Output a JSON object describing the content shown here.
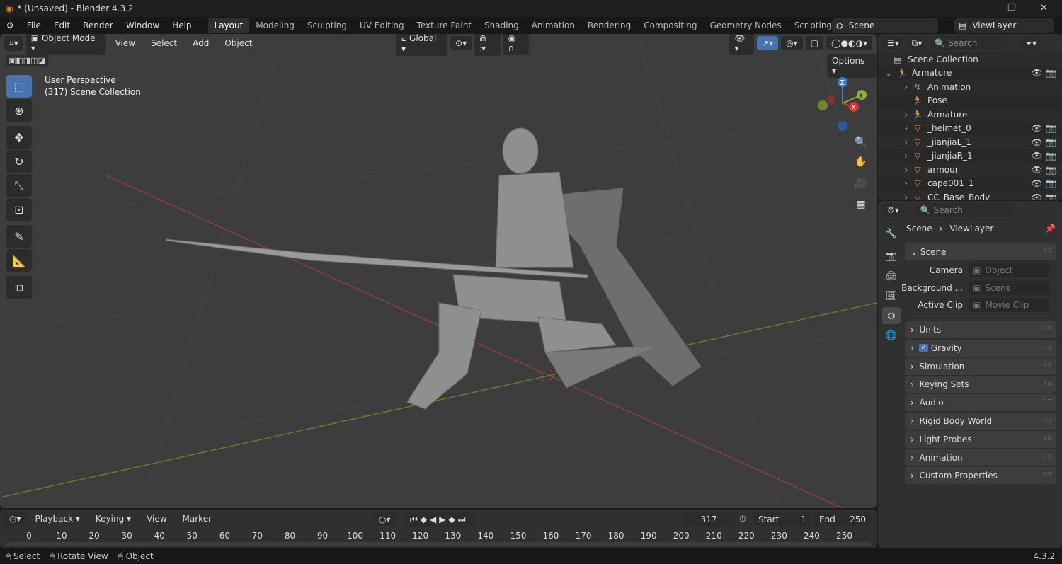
{
  "title": "* (Unsaved) - Blender 4.3.2",
  "menu": [
    "File",
    "Edit",
    "Render",
    "Window",
    "Help"
  ],
  "workspaces": [
    "Layout",
    "Modeling",
    "Sculpting",
    "UV Editing",
    "Texture Paint",
    "Shading",
    "Animation",
    "Rendering",
    "Compositing",
    "Geometry Nodes",
    "Scripting"
  ],
  "scene": "Scene",
  "view_layer": "ViewLayer",
  "viewport": {
    "mode": "Object Mode",
    "menus": [
      "View",
      "Select",
      "Add",
      "Object"
    ],
    "orientation": "Global",
    "options": "Options",
    "info1": "User Perspective",
    "info2": "(317) Scene Collection",
    "gizmo": {
      "z": "Z",
      "y": "Y",
      "x": "X"
    }
  },
  "outliner": {
    "search": "Search",
    "root": "Scene Collection",
    "rows": [
      {
        "name": "Armature",
        "icon": "armature",
        "indent": 1,
        "vis": true
      },
      {
        "name": "Animation",
        "icon": "action",
        "indent": 2,
        "vis": false
      },
      {
        "name": "Pose",
        "icon": "pose",
        "indent": 2,
        "vis": false
      },
      {
        "name": "Armature",
        "icon": "armature-data",
        "indent": 2,
        "vis": false
      },
      {
        "name": "_helmet_0",
        "icon": "mesh",
        "indent": 2,
        "vis": true
      },
      {
        "name": "_jianjiaL_1",
        "icon": "mesh",
        "indent": 2,
        "vis": true
      },
      {
        "name": "_jianjiaR_1",
        "icon": "mesh",
        "indent": 2,
        "vis": true
      },
      {
        "name": "armour",
        "icon": "mesh",
        "indent": 2,
        "vis": true
      },
      {
        "name": "cape001_1",
        "icon": "mesh",
        "indent": 2,
        "vis": true
      },
      {
        "name": "CC_Base_Body",
        "icon": "mesh",
        "indent": 2,
        "vis": true
      }
    ]
  },
  "properties": {
    "search": "Search",
    "breadcrumb": [
      "Scene",
      "ViewLayer"
    ],
    "scene_section": "Scene",
    "fields": [
      {
        "label": "Camera",
        "placeholder": "Object"
      },
      {
        "label": "Background ...",
        "placeholder": "Scene"
      },
      {
        "label": "Active Clip",
        "placeholder": "Movie Clip"
      }
    ],
    "sections": [
      "Units",
      "Gravity",
      "Simulation",
      "Keying Sets",
      "Audio",
      "Rigid Body World",
      "Light Probes",
      "Animation",
      "Custom Properties"
    ],
    "gravity_checked": true
  },
  "timeline": {
    "menus": [
      "Playback",
      "Keying",
      "View",
      "Marker"
    ],
    "current_frame": "317",
    "start_label": "Start",
    "start": "1",
    "end_label": "End",
    "end": "250",
    "ticks": [
      "0",
      "10",
      "20",
      "30",
      "40",
      "50",
      "60",
      "70",
      "80",
      "90",
      "100",
      "110",
      "120",
      "130",
      "140",
      "150",
      "160",
      "170",
      "180",
      "190",
      "200",
      "210",
      "220",
      "230",
      "240",
      "250"
    ]
  },
  "status": {
    "items": [
      "Select",
      "Rotate View",
      "Object"
    ],
    "version": "4.3.2"
  },
  "colors": {
    "accent": "#4772b3",
    "axis_x": "#c0392b",
    "axis_y": "#6a9a2a",
    "mesh_icon": "#e0883a"
  }
}
